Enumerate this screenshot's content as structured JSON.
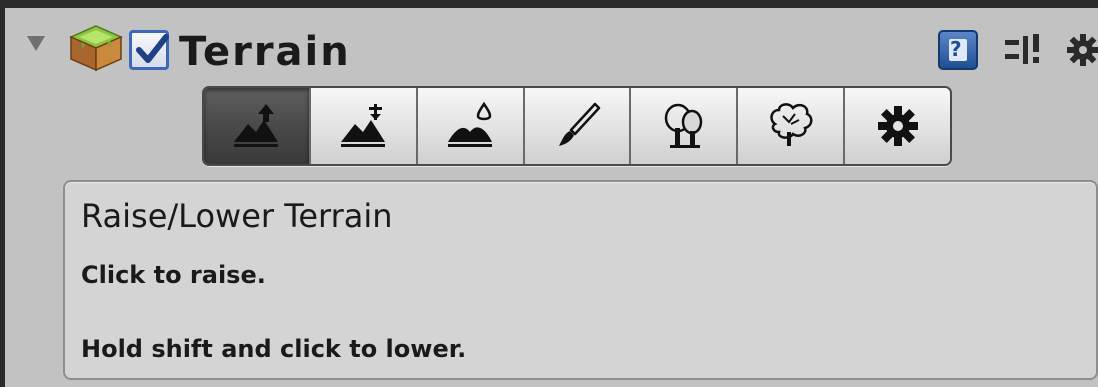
{
  "header": {
    "title": "Terrain",
    "enabled": true,
    "help_label": "?"
  },
  "toolbar": {
    "tools": [
      {
        "icon": "raise-lower-terrain-icon",
        "selected": true
      },
      {
        "icon": "paint-height-icon",
        "selected": false
      },
      {
        "icon": "smooth-height-icon",
        "selected": false
      },
      {
        "icon": "paint-texture-icon",
        "selected": false
      },
      {
        "icon": "place-trees-icon",
        "selected": false
      },
      {
        "icon": "paint-details-icon",
        "selected": false
      },
      {
        "icon": "terrain-settings-icon",
        "selected": false
      }
    ]
  },
  "info": {
    "title": "Raise/Lower Terrain",
    "line1": "Click to raise.",
    "line2": "Hold shift and click to lower."
  },
  "colors": {
    "panel_bg": "#c2c2c2",
    "active_tool": "#464646",
    "toggle_accent": "#3d68b8",
    "help_accent": "#1f4f92"
  }
}
